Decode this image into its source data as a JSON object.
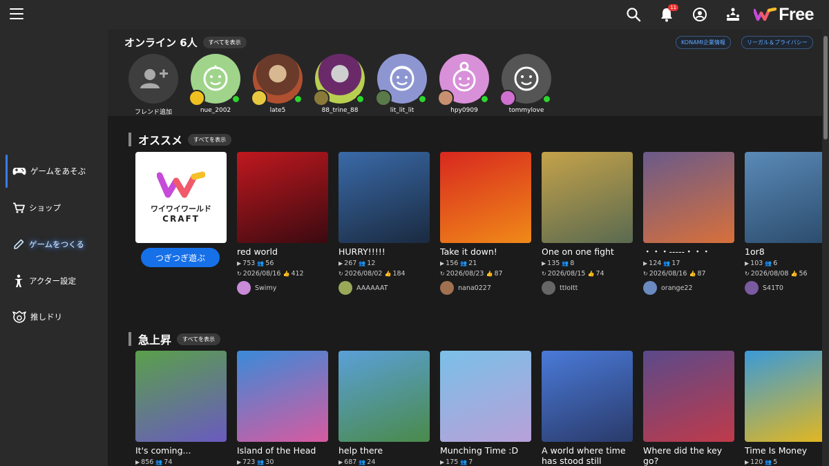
{
  "header": {
    "menu_icon": "hamburger-icon",
    "icons": [
      "search-icon",
      "bell-icon",
      "account-icon",
      "ranking-icon"
    ],
    "notification_count": "11",
    "brand": "Free"
  },
  "sidebar": {
    "items": [
      {
        "label": "ゲームをあそぶ",
        "icon": "gamepad-icon"
      },
      {
        "label": "ショップ",
        "icon": "cart-icon"
      },
      {
        "label": "ゲームをつくる",
        "icon": "pencil-icon"
      },
      {
        "label": "アクター設定",
        "icon": "actor-icon"
      },
      {
        "label": "推しドリ",
        "icon": "drill-icon"
      }
    ]
  },
  "online": {
    "title": "オンライン 6人",
    "show_all": "すべてを表示",
    "links": [
      "KONAMI企業情報",
      "リーガル＆プライバシー"
    ],
    "friends": [
      {
        "name": "フレンド追加",
        "color": "#444444"
      },
      {
        "name": "nue_2002",
        "color": "#9fd48a"
      },
      {
        "name": "late5",
        "color": "#8a4a3a"
      },
      {
        "name": "88_trine_88",
        "color": "#b9d050"
      },
      {
        "name": "lit_lit_lit",
        "color": "#8e96d2"
      },
      {
        "name": "hpy0909",
        "color": "#d890d8"
      },
      {
        "name": "tommylove",
        "color": "#555555"
      }
    ]
  },
  "recommended": {
    "title": "オススメ",
    "show_all": "すべてを表示",
    "featured": {
      "logo_line1": "ワイワイワールド",
      "logo_line2": "CRAFT",
      "button": "つぎつぎ遊ぶ"
    },
    "games": [
      {
        "title": "red world",
        "plays": "753",
        "players": "56",
        "date": "2026/08/16",
        "likes": "412",
        "creator": "Swimy",
        "c1": "#c0181f",
        "c2": "#3a0a10",
        "av": "#c98ad8"
      },
      {
        "title": "HURRY!!!!!",
        "plays": "267",
        "players": "12",
        "date": "2026/08/02",
        "likes": "184",
        "creator": "AAAAAAT",
        "c1": "#3a6aa8",
        "c2": "#1a2a40",
        "av": "#9aa85a"
      },
      {
        "title": "Take it down!",
        "plays": "156",
        "players": "21",
        "date": "2026/08/23",
        "likes": "87",
        "creator": "nana0227",
        "c1": "#d8281f",
        "c2": "#f08a18",
        "av": "#a07050"
      },
      {
        "title": "One on one fight",
        "plays": "135",
        "players": "8",
        "date": "2026/08/15",
        "likes": "74",
        "creator": "ttIoItt",
        "c1": "#c4a24a",
        "c2": "#5a6a50",
        "av": "#666666"
      },
      {
        "title": "・・・-----・・・",
        "plays": "124",
        "players": "17",
        "date": "2026/08/16",
        "likes": "87",
        "creator": "orange22",
        "c1": "#6a5a8a",
        "c2": "#d8703a",
        "av": "#6a8ac0"
      },
      {
        "title": "1or8",
        "plays": "103",
        "players": "6",
        "date": "2026/08/08",
        "likes": "56",
        "creator": "S41T0",
        "c1": "#5a8ab8",
        "c2": "#2a4a6a",
        "av": "#7a5aa0"
      }
    ]
  },
  "rising": {
    "title": "急上昇",
    "show_all": "すべてを表示",
    "games": [
      {
        "title": "It's coming...",
        "plays": "856",
        "players": "74",
        "c1": "#5aa04a",
        "c2": "#6a5ac0"
      },
      {
        "title": "Island of the Head",
        "plays": "723",
        "players": "30",
        "c1": "#3a8ad8",
        "c2": "#d85aa0"
      },
      {
        "title": "help there",
        "plays": "687",
        "players": "24",
        "c1": "#5aa0d8",
        "c2": "#4a8a4a"
      },
      {
        "title": "Munching Time :D",
        "plays": "175",
        "players": "7",
        "c1": "#7ac0e8",
        "c2": "#b8a0d8"
      },
      {
        "title": "A world where time has stood still",
        "plays": "",
        "players": "",
        "c1": "#4a7ad8",
        "c2": "#2a3a6a"
      },
      {
        "title": "Where did the key go?",
        "plays": "",
        "players": "",
        "c1": "#5a4a8a",
        "c2": "#c03a4a"
      },
      {
        "title": "Time Is Money",
        "plays": "120",
        "players": "5",
        "c1": "#3a9ad8",
        "c2": "#e8b81a"
      }
    ]
  }
}
